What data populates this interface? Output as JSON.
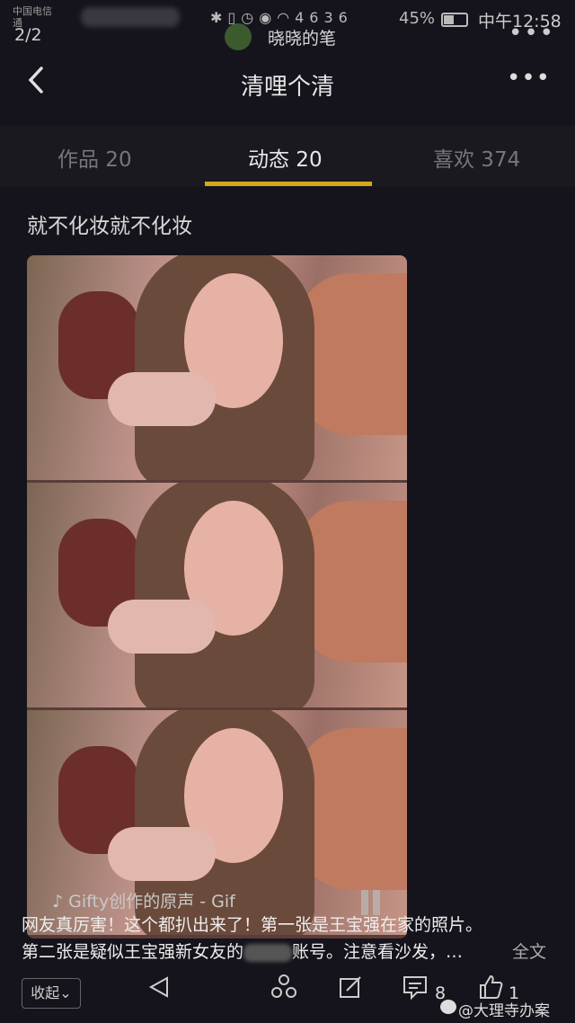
{
  "status_bar": {
    "carrier": "中国电信",
    "carrier2": "通",
    "battery": "45%",
    "time": "中午12:58",
    "signal": "46",
    "signal2": "36"
  },
  "viewer": {
    "counter": "2/2",
    "source_name": "晓晓的笔"
  },
  "header": {
    "title": "清哩个清",
    "more_label": "•••"
  },
  "tabs": [
    {
      "label": "作品 20"
    },
    {
      "label": "动态 20",
      "active": true
    },
    {
      "label": "喜欢 374"
    }
  ],
  "post": {
    "text": "就不化妆就不化妆",
    "gif_caption": "Gifty创作的原声 - Gif"
  },
  "overlay": {
    "line1": "网友真厉害！这个都扒出来了！第一张是王宝强在家的照片。",
    "line2_a": "第二张是疑似王宝强新女友的",
    "line2_b": "账号。注意看沙发，…",
    "full_text": "全文"
  },
  "bottom": {
    "collapse_label": "收起",
    "comment_count": "8",
    "like_count": "1",
    "watermark": "@大理寺办案"
  },
  "colors": {
    "background": "#15141c",
    "tab_underline": "#d4a917"
  },
  "icons": [
    "back-arrow-icon",
    "more-icon",
    "play-icon",
    "share-icon",
    "repost-icon",
    "comment-icon",
    "like-icon",
    "pause-icon",
    "music-icon",
    "weibo-logo-icon"
  ]
}
